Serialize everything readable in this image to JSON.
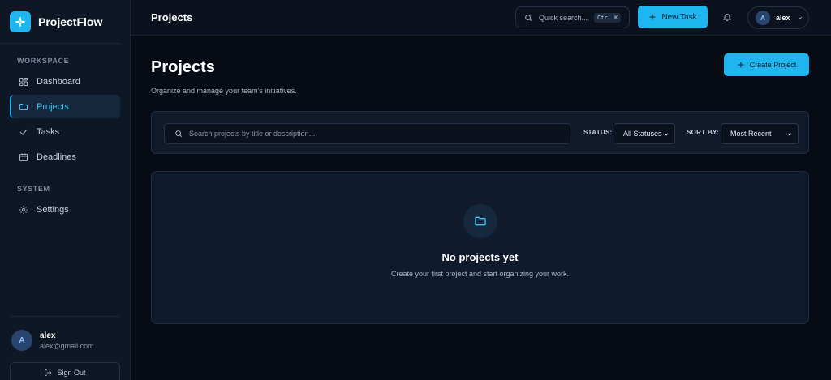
{
  "brand": {
    "name": "ProjectFlow",
    "logo_icon": "sparkle-icon"
  },
  "sidebar": {
    "sections": [
      {
        "label": "WORKSPACE"
      },
      {
        "label": "SYSTEM"
      }
    ],
    "items": [
      {
        "label": "Dashboard",
        "icon": "grid-icon",
        "active": false
      },
      {
        "label": "Projects",
        "icon": "folder-icon",
        "active": true
      },
      {
        "label": "Tasks",
        "icon": "check-icon",
        "active": false
      },
      {
        "label": "Deadlines",
        "icon": "calendar-icon",
        "active": false
      },
      {
        "label": "Settings",
        "icon": "gear-icon",
        "active": false
      }
    ],
    "user": {
      "initial": "A",
      "name": "alex",
      "email": "alex@gmail.com"
    },
    "sign_out_label": "Sign Out"
  },
  "topbar": {
    "title": "Projects",
    "quick_search": {
      "placeholder": "Quick search...",
      "shortcut": "Ctrl K"
    },
    "new_task_label": "New Task",
    "user": {
      "initial": "A",
      "name": "alex"
    }
  },
  "page": {
    "title": "Projects",
    "subtitle": "Organize and manage your team's initiatives.",
    "create_label": "Create Project"
  },
  "filters": {
    "search_placeholder": "Search projects by title or description...",
    "status_label": "STATUS:",
    "status_value": "All Statuses",
    "sort_label": "SORT BY:",
    "sort_value": "Most Recent"
  },
  "empty_state": {
    "title": "No projects yet",
    "description": "Create your first project and start organizing your work."
  },
  "colors": {
    "accent": "#1fb6f0",
    "background": "#070b14",
    "sidebar": "#0e1726",
    "card": "#101a2b"
  }
}
